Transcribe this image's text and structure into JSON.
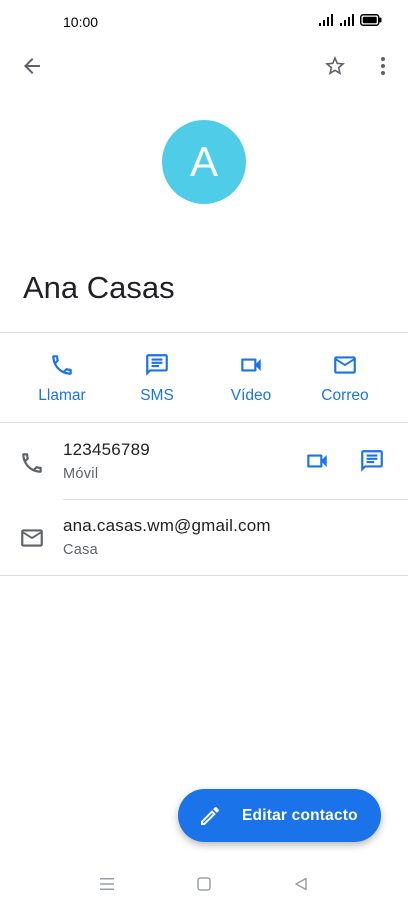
{
  "status_bar": {
    "time": "10:00",
    "icons": [
      "wifi-icon",
      "signal-icon",
      "signal-icon",
      "battery-icon"
    ]
  },
  "top_bar": {
    "icons": [
      "back-arrow-icon",
      "star-outline-icon",
      "more-vert-icon"
    ]
  },
  "contact": {
    "avatar_letter": "A",
    "avatar_color": "#4fcde8",
    "name": "Ana Casas"
  },
  "actions": [
    {
      "label": "Llamar",
      "icon": "phone-icon"
    },
    {
      "label": "SMS",
      "icon": "message-icon"
    },
    {
      "label": "Vídeo",
      "icon": "videocam-icon"
    },
    {
      "label": "Correo",
      "icon": "mail-icon"
    }
  ],
  "details": {
    "phone": {
      "value": "123456789",
      "type": "Móvil"
    },
    "email": {
      "value": "ana.casas.wm@gmail.com",
      "type": "Casa"
    }
  },
  "fab": {
    "label": "Editar contacto",
    "icon": "pencil-icon"
  },
  "nav_bar": {
    "icons": [
      "menu-icon",
      "home-square-icon",
      "back-triangle-icon"
    ]
  },
  "colors": {
    "accent": "#1a73e8",
    "text_primary": "#202124",
    "text_secondary": "#5f6368",
    "divider": "#dadce0"
  }
}
